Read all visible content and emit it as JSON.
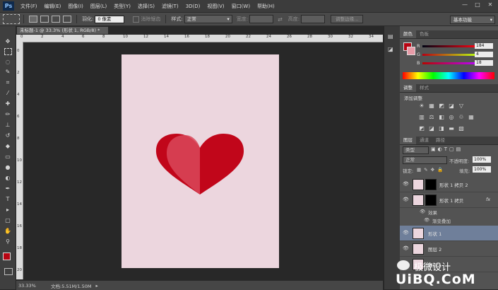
{
  "app": {
    "logo": "Ps"
  },
  "menu": [
    "文件(F)",
    "编辑(E)",
    "图像(I)",
    "图层(L)",
    "类型(Y)",
    "选择(S)",
    "滤镜(T)",
    "3D(D)",
    "视图(V)",
    "窗口(W)",
    "帮助(H)"
  ],
  "window_buttons": [
    "—",
    "□",
    "✕"
  ],
  "options": {
    "feather_label": "羽化:",
    "feather_value": "0 像素",
    "antialias_label": "消除锯齿",
    "style_label": "样式:",
    "style_value": "正常",
    "width_label": "宽度:",
    "height_label": "高度:",
    "refine_edge": "调整边缘...",
    "workspace": "基本功能"
  },
  "document": {
    "tab_title": "未标题-1 @ 33.3% (形状 1, RGB/8) *",
    "zoom": "33.33%",
    "doc_info": "文档:5.51M/1.50M",
    "ruler_top": [
      "0",
      "2",
      "4",
      "6",
      "8",
      "10",
      "12",
      "14",
      "16",
      "18",
      "20",
      "22",
      "24",
      "26",
      "28",
      "30",
      "32",
      "34"
    ],
    "ruler_left": [
      "0",
      "2",
      "4",
      "6",
      "8",
      "10",
      "12",
      "14",
      "16",
      "18",
      "20"
    ]
  },
  "color_panel": {
    "tabs": [
      "颜色",
      "色板"
    ],
    "channels": [
      {
        "label": "R",
        "value": "184"
      },
      {
        "label": "G",
        "value": "4"
      },
      {
        "label": "B",
        "value": "18"
      }
    ],
    "fg_color": "#b80412",
    "bg_color": "#e79ba7"
  },
  "adjust_panel": {
    "tabs": [
      "调整",
      "样式"
    ],
    "title": "添加调整"
  },
  "layers_panel": {
    "tabs": [
      "图层",
      "通道",
      "路径"
    ],
    "filter": "类型",
    "blend_mode": "正常",
    "opacity_label": "不透明度:",
    "opacity_value": "100%",
    "lock_label": "锁定:",
    "fill_label": "填充:",
    "fill_value": "100%",
    "layers": [
      {
        "name": "形状 1 拷贝 2",
        "selected": false
      },
      {
        "name": "形状 1 拷贝",
        "selected": false,
        "fx": "fx"
      },
      {
        "name": "形状 1",
        "selected": true
      },
      {
        "name": "图层 2",
        "selected": false
      },
      {
        "name": "图层 1",
        "selected": false
      }
    ],
    "effects_label": "效果",
    "effect_item": "渐变叠加"
  },
  "watermark": {
    "text": "极微设计",
    "brand": "UiBQ.CoM"
  }
}
